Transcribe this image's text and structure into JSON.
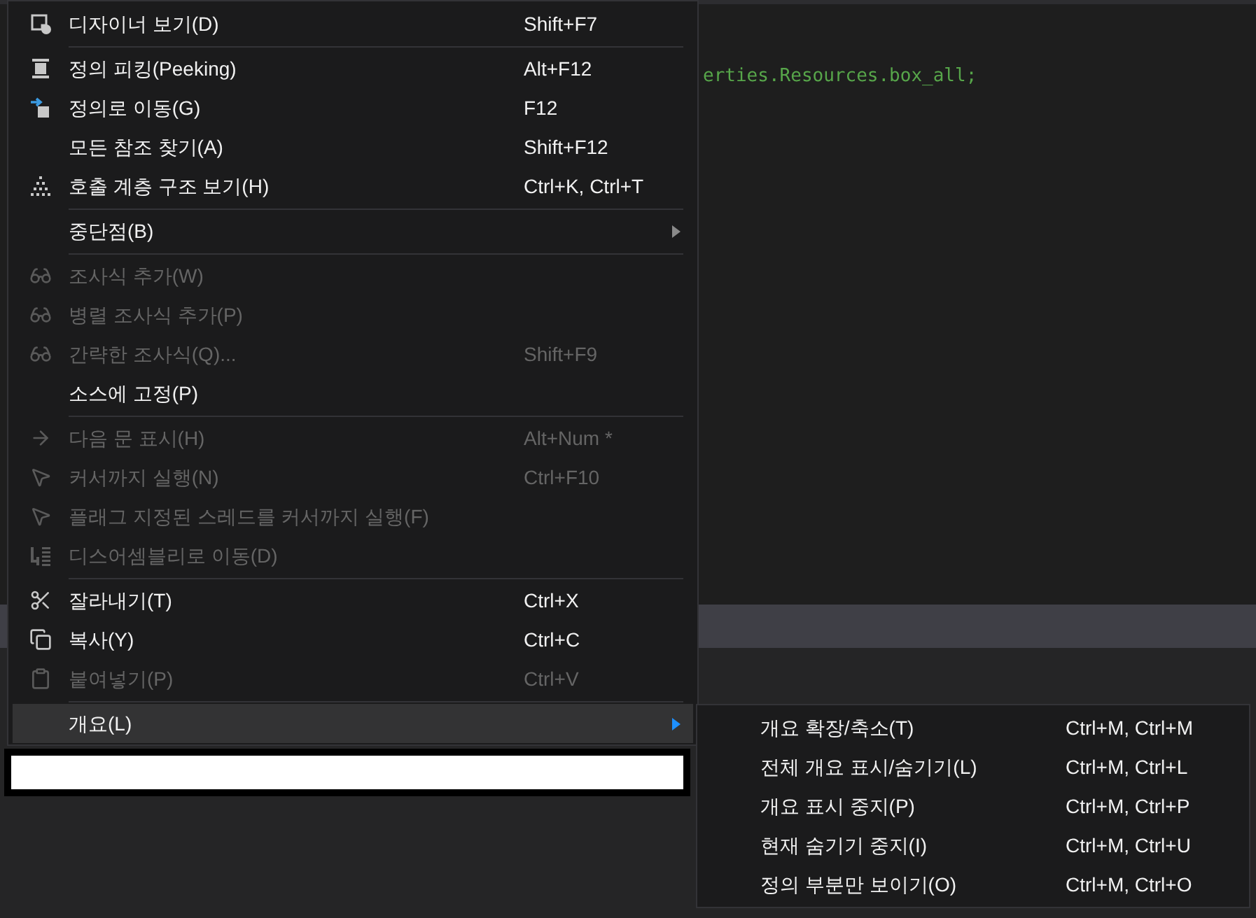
{
  "editor": {
    "code_line": "erties.Resources.box_all;"
  },
  "context_menu": {
    "groups": [
      [
        {
          "label": "디자이너 보기(D)",
          "shortcut": "Shift+F7",
          "disabled": false,
          "has_submenu": false,
          "selected": false
        }
      ],
      [
        {
          "label": "정의 피킹(Peeking)",
          "shortcut": "Alt+F12",
          "disabled": false,
          "has_submenu": false,
          "selected": false
        },
        {
          "label": "정의로 이동(G)",
          "shortcut": "F12",
          "disabled": false,
          "has_submenu": false,
          "selected": false
        },
        {
          "label": "모든 참조 찾기(A)",
          "shortcut": "Shift+F12",
          "disabled": false,
          "has_submenu": false,
          "selected": false
        },
        {
          "label": "호출 계층 구조 보기(H)",
          "shortcut": "Ctrl+K, Ctrl+T",
          "disabled": false,
          "has_submenu": false,
          "selected": false
        }
      ],
      [
        {
          "label": "중단점(B)",
          "disabled": false,
          "has_submenu": true,
          "selected": false
        }
      ],
      [
        {
          "label": "조사식 추가(W)",
          "disabled": true,
          "has_submenu": false,
          "selected": false
        },
        {
          "label": "병렬 조사식 추가(P)",
          "disabled": true,
          "has_submenu": false,
          "selected": false
        },
        {
          "label": "간략한 조사식(Q)...",
          "shortcut": "Shift+F9",
          "disabled": true,
          "has_submenu": false,
          "selected": false
        },
        {
          "label": "소스에 고정(P)",
          "disabled": false,
          "has_submenu": false,
          "selected": false
        }
      ],
      [
        {
          "label": "다음 문 표시(H)",
          "shortcut": "Alt+Num *",
          "disabled": true,
          "has_submenu": false,
          "selected": false
        },
        {
          "label": "커서까지 실행(N)",
          "shortcut": "Ctrl+F10",
          "disabled": true,
          "has_submenu": false,
          "selected": false
        },
        {
          "label": "플래그 지정된 스레드를 커서까지 실행(F)",
          "disabled": true,
          "has_submenu": false,
          "selected": false
        },
        {
          "label": "디스어셈블리로 이동(D)",
          "disabled": true,
          "has_submenu": false,
          "selected": false
        }
      ],
      [
        {
          "label": "잘라내기(T)",
          "shortcut": "Ctrl+X",
          "disabled": false,
          "has_submenu": false,
          "selected": false
        },
        {
          "label": "복사(Y)",
          "shortcut": "Ctrl+C",
          "disabled": false,
          "has_submenu": false,
          "selected": false
        },
        {
          "label": "붙여넣기(P)",
          "shortcut": "Ctrl+V",
          "disabled": true,
          "has_submenu": false,
          "selected": false
        }
      ],
      [
        {
          "label": "개요(L)",
          "disabled": false,
          "has_submenu": true,
          "selected": true
        }
      ]
    ]
  },
  "submenu": {
    "items": [
      {
        "label": "개요 확장/축소(T)",
        "shortcut": "Ctrl+M, Ctrl+M"
      },
      {
        "label": "전체 개요 표시/숨기기(L)",
        "shortcut": "Ctrl+M, Ctrl+L"
      },
      {
        "label": "개요 표시 중지(P)",
        "shortcut": "Ctrl+M, Ctrl+P"
      },
      {
        "label": "현재 숨기기 중지(I)",
        "shortcut": "Ctrl+M, Ctrl+U"
      },
      {
        "label": "정의 부분만 보이기(O)",
        "shortcut": "Ctrl+M, Ctrl+O"
      }
    ]
  }
}
